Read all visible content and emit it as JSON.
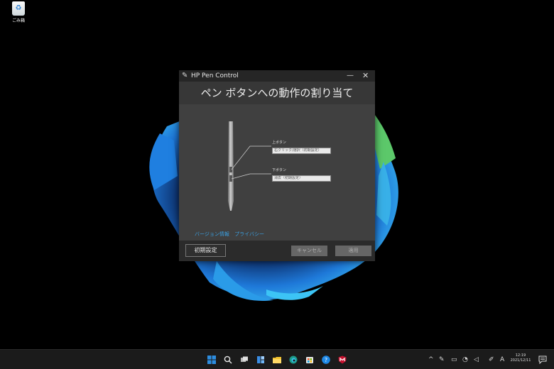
{
  "desktop": {
    "recycle_bin_label": "ごみ箱",
    "recycle_bin_icon": "recycle-bin-icon"
  },
  "window": {
    "app_icon": "pen-icon",
    "title": "HP Pen Control",
    "minimize_glyph": "—",
    "close_glyph": "✕",
    "header": "ペン ボタンへの動作の割り当て",
    "upper_button": {
      "label": "上ボタン",
      "value": "右クリック/選択（初期設定）"
    },
    "lower_button": {
      "label": "下ボタン",
      "value": "消去（初期設定）"
    },
    "links": {
      "version": "バージョン情報",
      "privacy": "プライバシー"
    },
    "buttons": {
      "reset": "初期設定",
      "cancel": "キャンセル",
      "apply": "適用"
    }
  },
  "taskbar": {
    "pinned_icons": [
      "windows-start-icon",
      "search-icon",
      "task-view-icon",
      "widgets-icon",
      "file-explorer-icon",
      "edge-icon",
      "store-icon",
      "help-icon",
      "mcafee-icon"
    ],
    "tray": {
      "chevron": "^",
      "ime": "A",
      "icons": [
        "pen-tray-icon",
        "battery-icon",
        "network-icon",
        "volume-icon"
      ]
    },
    "time": "12:19",
    "date": "2021/12/11"
  },
  "colors": {
    "desktop_bg": "#000000",
    "window_bg": "#404040",
    "header_bg": "#373737",
    "link": "#3a9fe0",
    "disabled_button": "#666666"
  }
}
